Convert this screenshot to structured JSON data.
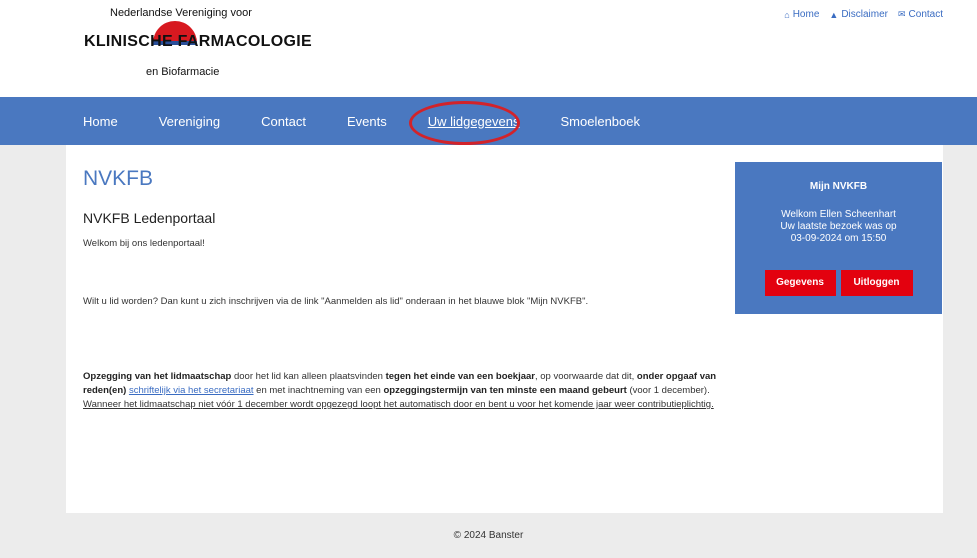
{
  "logo": {
    "line1": "Nederlandse Vereniging voor",
    "main_a": "KLINISCHE ",
    "main_b": "FARMACOLOGIE",
    "line3": "en Biofarmacie"
  },
  "toplinks": [
    {
      "icon": "home-icon",
      "glyph": "⌂",
      "label": "Home"
    },
    {
      "icon": "warning-icon",
      "glyph": "▲",
      "label": "Disclaimer"
    },
    {
      "icon": "mail-icon",
      "glyph": "✉",
      "label": "Contact"
    }
  ],
  "nav": [
    {
      "label": "Home"
    },
    {
      "label": "Vereniging"
    },
    {
      "label": "Contact"
    },
    {
      "label": "Events"
    },
    {
      "label": "Uw lidgegevens"
    },
    {
      "label": "Smoelenboek"
    }
  ],
  "main": {
    "title": "NVKFB",
    "subtitle": "NVKFB Ledenportaal",
    "welcome": "Welkom bij ons ledenportaal!",
    "join": "Wilt u lid worden? Dan kunt u zich inschrijven via de link \"Aanmelden als lid\" onderaan in het blauwe blok \"Mijn NVKFB\".",
    "p1_b1": "Opzegging van het lidmaatschap",
    "p1_t1": " door het lid kan alleen plaatsvinden ",
    "p1_b2": "tegen het einde van een boekjaar",
    "p1_t2": ", op voorwaarde dat dit, ",
    "p1_b3": "onder opgaaf van reden(en)",
    "p1_link": "schriftelijk via het secretariaat",
    "p1_t3": " en met inachtneming van een ",
    "p1_b4": "opzeggingstermijn van ten minste een maand gebeurt",
    "p1_t4": " (voor 1 december). ",
    "p1_ul": "Wanneer het lidmaatschap niet vóór 1 december wordt opgezegd loopt het automatisch door en bent u voor het komende jaar weer contributieplichtig."
  },
  "sidebox": {
    "title": "Mijn NVKFB",
    "welcome": "Welkom Ellen Scheenhart",
    "last_visit": "Uw laatste bezoek was op",
    "date": "03-09-2024 om 15:50",
    "btn_gegevens": "Gegevens",
    "btn_uitloggen": "Uitloggen"
  },
  "footer": "© 2024 Banster",
  "colors": {
    "nav": "#4a78c0",
    "button": "#e3010f",
    "highlight_circle": "#d2232a"
  }
}
